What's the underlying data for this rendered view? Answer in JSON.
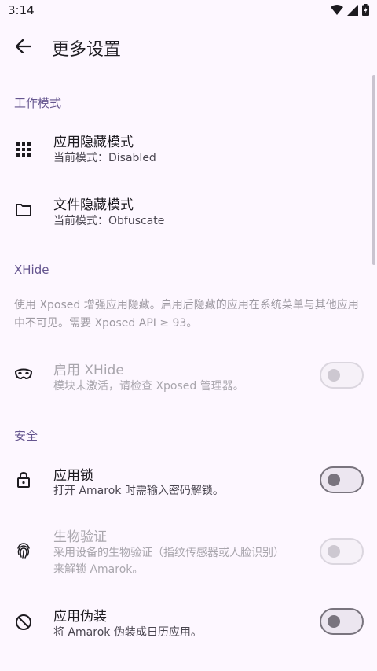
{
  "status": {
    "time": "3:14"
  },
  "header": {
    "title": "更多设置"
  },
  "sections": {
    "work_mode": "工作模式",
    "xhide": "XHide",
    "security": "安全"
  },
  "items": {
    "app_hide": {
      "title": "应用隐藏模式",
      "sub": "当前模式：Disabled",
      "icon": "apps-grid-icon"
    },
    "file_hide": {
      "title": "文件隐藏模式",
      "sub": "当前模式：Obfuscate",
      "icon": "folder-icon"
    },
    "xhide_info": "使用 Xposed 增强应用隐藏。启用后隐藏的应用在系统菜单与其他应用中不可见。需要 Xposed API ≥ 93。",
    "xhide_enable": {
      "title": "启用 XHide",
      "sub": "模块未激活，请检查 Xposed 管理器。",
      "icon": "mask-icon",
      "enabled": false
    },
    "app_lock": {
      "title": "应用锁",
      "sub": "打开 Amarok 时需输入密码解锁。",
      "icon": "lock-icon",
      "enabled": false
    },
    "biometric": {
      "title": "生物验证",
      "sub_line1": "采用设备的生物验证（指纹传感器或人脸识别）",
      "sub_line2": "来解锁 Amarok。",
      "icon": "fingerprint-icon",
      "enabled": false
    },
    "disguise": {
      "title": "应用伪装",
      "sub": "将 Amarok 伪装成日历应用。",
      "icon": "no-camera-icon",
      "enabled": false
    }
  }
}
